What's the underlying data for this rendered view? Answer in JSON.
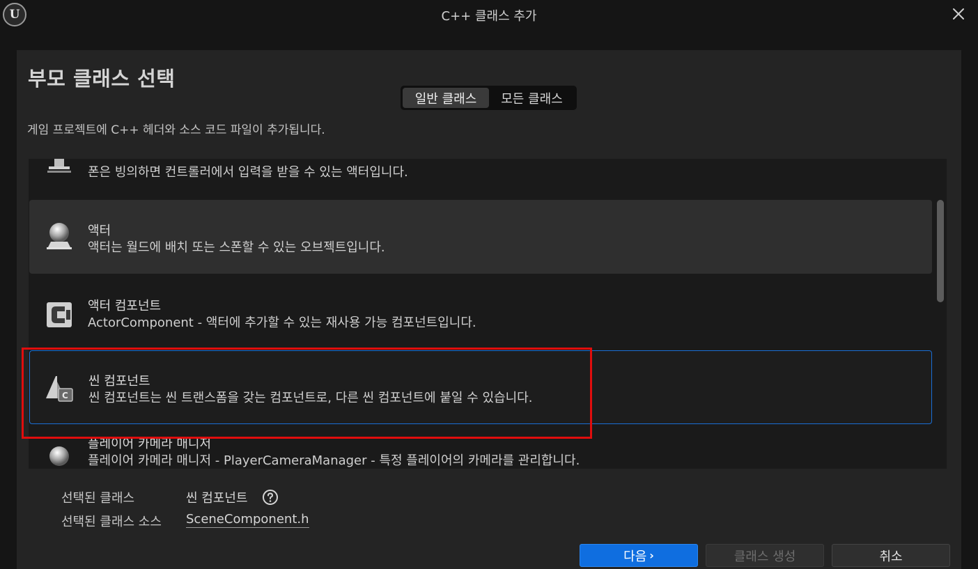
{
  "window": {
    "title": "C++ 클래스 추가",
    "logo": "U"
  },
  "panel": {
    "heading": "부모 클래스 선택",
    "tabs": [
      {
        "label": "일반 클래스",
        "active": true
      },
      {
        "label": "모든 클래스",
        "active": false
      }
    ],
    "description": "게임 프로젝트에 C++ 헤더와 소스 코드 파일이 추가됩니다."
  },
  "class_list": {
    "items": [
      {
        "title": "",
        "subtitle": "폰은 빙의하면 컨트롤러에서 입력을 받을 수 있는 액터입니다.",
        "icon": "pawn-icon"
      },
      {
        "title": "액터",
        "subtitle": "액터는 월드에 배치 또는 스폰할 수 있는 오브젝트입니다.",
        "icon": "actor-sphere-icon",
        "state": "hover"
      },
      {
        "title": "액터 컴포넌트",
        "subtitle": "ActorComponent - 액터에 추가할 수 있는 재사용 가능 컴포넌트입니다.",
        "icon": "component-icon"
      },
      {
        "title": "씬 컴포넌트",
        "subtitle": "씬 컴포넌트는 씬 트랜스폼을 갖는 컴포넌트로, 다른 씬 컴포넌트에 붙일 수 있습니다.",
        "icon": "scene-component-icon",
        "state": "selected"
      },
      {
        "title": "플레이어 카메라 매니저",
        "subtitle": "플레이어 카메라 매니저 - PlayerCameraManager - 특정 플레이어의 카메라를 관리합니다.",
        "icon": "actor-sphere-icon"
      }
    ]
  },
  "selection": {
    "class_label": "선택된 클래스",
    "class_value": "씬 컴포넌트",
    "source_label": "선택된 클래스 소스",
    "source_value": "SceneComponent.h"
  },
  "buttons": {
    "next": "다음",
    "create": "클래스 생성",
    "cancel": "취소"
  },
  "colors": {
    "accent": "#0f6ee0",
    "selection_border": "#1a6fd6",
    "annotation_red": "#e00d0d"
  }
}
